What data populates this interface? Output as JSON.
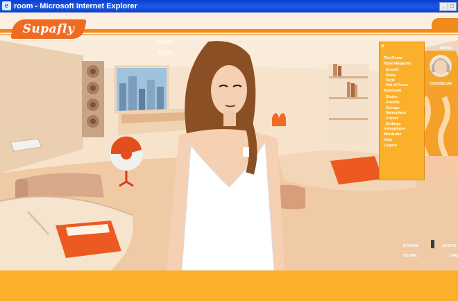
{
  "window": {
    "title": "room - Microsoft Internet Explorer",
    "controls": [
      "minimize-icon",
      "maximize-icon"
    ]
  },
  "header": {
    "logo_text": "Supafly"
  },
  "menu": {
    "tab_label": "MENU",
    "close": "×",
    "items": [
      {
        "label": "The Room",
        "indent": false
      },
      {
        "label": "Hype Magazine",
        "indent": false
      },
      {
        "label": "Search",
        "indent": true
      },
      {
        "label": "News",
        "indent": true
      },
      {
        "label": "Style",
        "indent": true
      },
      {
        "label": "Hot of Press",
        "indent": true
      },
      {
        "label": "Notebook",
        "indent": false
      },
      {
        "label": "Status",
        "indent": true
      },
      {
        "label": "Friends",
        "indent": true
      },
      {
        "label": "Groups",
        "indent": true
      },
      {
        "label": "Nameplays",
        "indent": true
      },
      {
        "label": "Corner",
        "indent": true
      },
      {
        "label": "Settings",
        "indent": true
      },
      {
        "label": "Videophone",
        "indent": false
      },
      {
        "label": "Wardrobe",
        "indent": false
      },
      {
        "label": "Help",
        "indent": false
      },
      {
        "label": "Logout",
        "indent": false
      }
    ]
  },
  "counselor": {
    "label": "COUNSELOR"
  },
  "hud": {
    "status_label": "STATUS:",
    "status_value": "ACTIVE",
    "score_label": "SCORE:",
    "score_value": "1442"
  },
  "colors": {
    "accent": "#f08a1c",
    "footer": "#fbb02c",
    "menu_bg": "#fbb02c",
    "wall": "#f9ead8"
  }
}
